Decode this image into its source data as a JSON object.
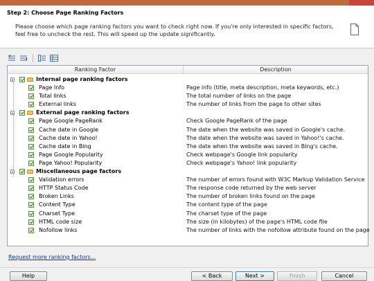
{
  "header": {
    "step_title": "Step 2: Choose Page Ranking Factors",
    "description": "Please choose which page ranking factors you want to check right now. If you're only interested in specific factors, feel free to uncheck the rest. This will speed up the update significantly."
  },
  "toolbar": {
    "buttons": [
      "expand-all-icon",
      "collapse-all-icon",
      "check-all-icon",
      "uncheck-all-icon"
    ]
  },
  "grid": {
    "columns": {
      "factor": "Ranking Factor",
      "description": "Description"
    },
    "groups": [
      {
        "label": "Internal page ranking factors",
        "items": [
          {
            "label": "Page Info",
            "description": "Page info (title, meta description, meta keywords, etc.)"
          },
          {
            "label": "Total links",
            "description": "The total number of links on the page"
          },
          {
            "label": "External links",
            "description": "The number of links from the page to other sites"
          }
        ]
      },
      {
        "label": "External page ranking factors",
        "items": [
          {
            "label": "Page Google PageRank",
            "description": "Check Google PageRank of the page"
          },
          {
            "label": "Cache date in Google",
            "description": "The date when the website was saved in Google's cache."
          },
          {
            "label": "Cache date in Yahoo!",
            "description": "The date when the website was saved in Yahoo!'s cache."
          },
          {
            "label": "Cache date in Bing",
            "description": "The date when the website was saved in Bing's cache."
          },
          {
            "label": "Page Google Popularity",
            "description": "Check webpage's Google link popularity"
          },
          {
            "label": "Page Yahoo! Popularity",
            "description": "Check webpage's Yahoo! link popularity"
          }
        ]
      },
      {
        "label": "Miscellaneous page factors",
        "items": [
          {
            "label": "Validation  errors",
            "description": "The number of errors found with W3C Markup Validation Service"
          },
          {
            "label": "HTTP Status Code",
            "description": "The response code returned by the web server"
          },
          {
            "label": "Broken Links",
            "description": "The number of broken links found on the page"
          },
          {
            "label": "Content Type",
            "description": "The content type of the page"
          },
          {
            "label": "Charset Type",
            "description": "The charset type of the page"
          },
          {
            "label": "HTML code size",
            "description": "The size (in kilobytes) of the page's HTML code file"
          },
          {
            "label": "Nofollow links",
            "description": "The number of links with the nofollow attribute found on the page"
          }
        ]
      }
    ]
  },
  "link": {
    "request_more": "Request more ranking factors..."
  },
  "footer": {
    "help": "Help",
    "back": "< Back",
    "next": "Next >",
    "finish": "Finish",
    "cancel": "Cancel"
  },
  "colors": {
    "title_bar": "#c06a3a",
    "link": "#0033cc",
    "check": "#2d7a1f"
  }
}
